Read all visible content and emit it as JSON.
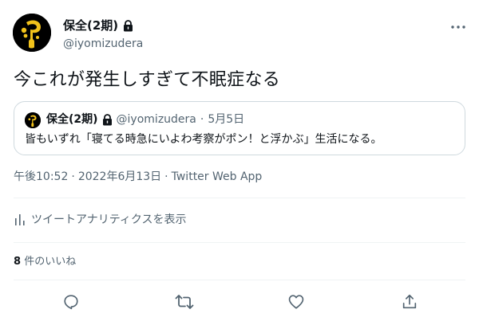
{
  "author": {
    "display_name": "保全(2期)",
    "handle": "@iyomizudera"
  },
  "tweet": {
    "text": "今これが発生しすぎて不眠症なる"
  },
  "quoted_tweet": {
    "display_name": "保全(2期)",
    "handle": "@iyomizudera",
    "separator": "·",
    "date": "5月5日",
    "text": "皆もいずれ「寝てる時急にいよわ考察がポン！と浮かぶ」生活になる。"
  },
  "meta": {
    "time": "午後10:52",
    "separator1": "·",
    "date": "2022年6月13日",
    "separator2": "·",
    "app": "Twitter Web App"
  },
  "analytics": {
    "label": "ツイートアナリティクスを表示"
  },
  "likes": {
    "count": "8",
    "label": "件のいいね"
  },
  "icons": {
    "lock": "lock-icon",
    "more": "more-horizontal-icon",
    "analytics": "bar-chart-icon",
    "reply": "reply-icon",
    "retweet": "retweet-icon",
    "like": "heart-icon",
    "share": "share-icon"
  },
  "colors": {
    "text_primary": "#0f1419",
    "text_secondary": "#536471",
    "border": "#cfd9de",
    "divider": "#eff3f4",
    "avatar_gold": "#f2c21b"
  }
}
